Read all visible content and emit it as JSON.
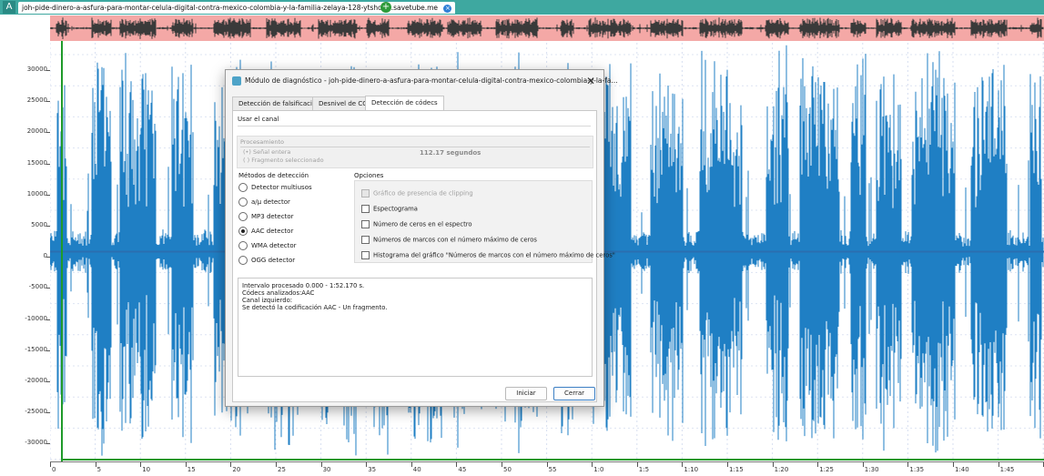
{
  "window": {
    "app_letter": "A",
    "file_tab": "joh-pide-dinero-a-asfura-para-montar-celula-digital-contra-mexico-colombia-y-la-familia-zelaya-128-ytshorts.savetube.me",
    "close_glyph": "×",
    "new_tab_glyph": "+"
  },
  "y_axis": {
    "ticks": [
      "30000",
      "25000",
      "20000",
      "15000",
      "10000",
      "5000",
      "0",
      "-5000",
      "-10000",
      "-15000",
      "-20000",
      "-25000",
      "-30000"
    ]
  },
  "x_axis": {
    "ticks": [
      "0",
      "5",
      "10",
      "15",
      "20",
      "25",
      "30",
      "35",
      "40",
      "45",
      "50",
      "55",
      "1:0",
      "1:5",
      "1:10",
      "1:15",
      "1:20",
      "1:25",
      "1:30",
      "1:35",
      "1:40",
      "1:45",
      "1:5"
    ]
  },
  "dialog": {
    "title": "Módulo de diagnóstico - joh-pide-dinero-a-asfura-para-montar-celula-digital-contra-mexico-colombia-y-la-fa...",
    "close_glyph": "✕",
    "tabs": [
      "Detección de falsificación",
      "Desnivel de CC",
      "Detección de códecs"
    ],
    "active_tab": "Detección de códecs",
    "use_channel": "Usar el canal",
    "processing": {
      "label": "Procesamiento",
      "option_whole": "(•) Señal entera",
      "option_fragment": "( ) Fragmento seleccionado",
      "duration": "112.17 segundos"
    },
    "methods": {
      "title": "Métodos de detección",
      "items": [
        "Detector multiusos",
        "a/µ detector",
        "MP3 detector",
        "AAC detector",
        "WMA detector",
        "OGG detector"
      ],
      "selected": "AAC detector"
    },
    "options": {
      "title": "Opciones",
      "items": [
        "Gráfico de presencia de clipping",
        "Espectograma",
        "Número de ceros en el espectro",
        "Números de marcos con el número máximo de ceros",
        "Histograma del gráfico \"Números de marcos con el número máximo de ceros\""
      ]
    },
    "result_lines": [
      "Intervalo procesado 0.000 - 1:52.170 s.",
      "Códecs analizados:AAC",
      "Canal izquierdo:",
      "Se detectó la codificación AAC - Un fragmento."
    ],
    "buttons": {
      "start": "Iniciar",
      "close": "Cerrar"
    }
  },
  "colors": {
    "waveform": "#1f7fc4",
    "overview_background": "#f4a8a6",
    "tab_bar": "#3ea8a0",
    "selection_marker": "#1f9a2a"
  }
}
